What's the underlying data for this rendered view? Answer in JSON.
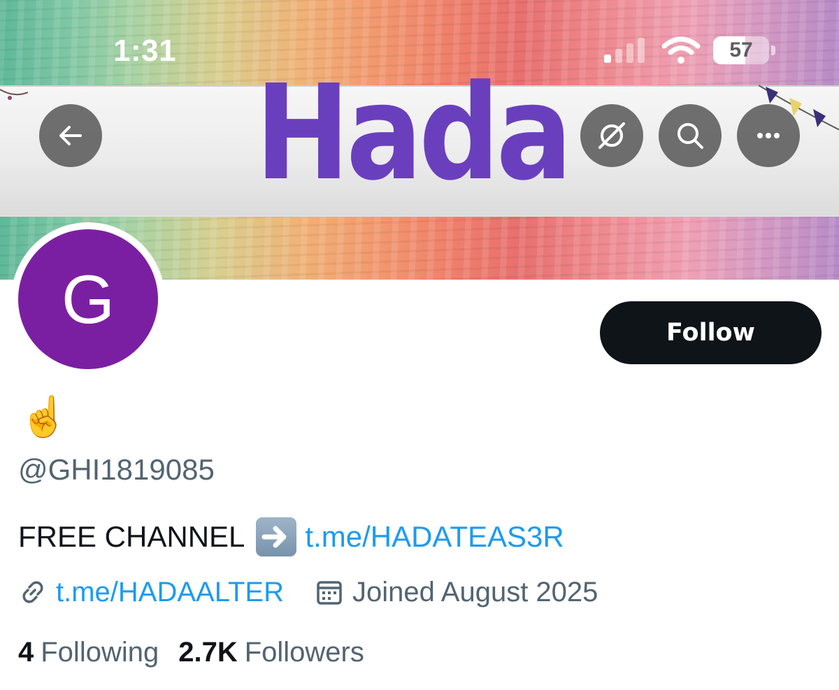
{
  "status_bar": {
    "time": "1:31",
    "battery_percent": "57",
    "battery_level": 0.57
  },
  "banner": {
    "logo_text": "Hada"
  },
  "top_actions": {
    "back_icon": "arrow-left-icon",
    "grok_icon": "slashed-circle-icon",
    "search_icon": "search-icon",
    "more_icon": "more-dots-icon"
  },
  "profile": {
    "avatar_letter": "G",
    "avatar_color": "#7b1fa2",
    "display_name": "☝️",
    "handle": "@GHI1819085",
    "follow_label": "Follow",
    "bio": {
      "text": "FREE CHANNEL",
      "arrow_icon": "right-arrow-emoji-icon",
      "link": "t.me/HADATEAS3R"
    },
    "website": "t.me/HADAALTER",
    "joined": "Joined August 2025",
    "following_count": "4",
    "following_label": "Following",
    "followers_count": "2.7K",
    "followers_label": "Followers"
  },
  "colors": {
    "accent_link": "#1d9bf0",
    "muted_text": "#536471",
    "primary_text": "#0f1419",
    "follow_button": "#0f1419"
  }
}
